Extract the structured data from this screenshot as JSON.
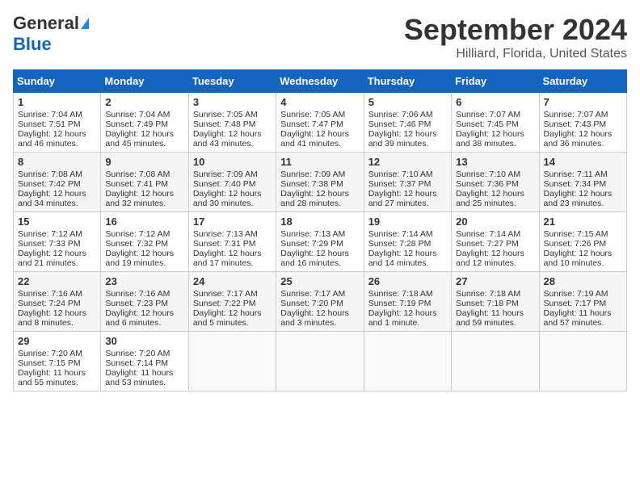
{
  "header": {
    "logo_general": "General",
    "logo_blue": "Blue",
    "month": "September 2024",
    "location": "Hilliard, Florida, United States"
  },
  "days_of_week": [
    "Sunday",
    "Monday",
    "Tuesday",
    "Wednesday",
    "Thursday",
    "Friday",
    "Saturday"
  ],
  "weeks": [
    [
      {
        "day": "1",
        "lines": [
          "Sunrise: 7:04 AM",
          "Sunset: 7:51 PM",
          "Daylight: 12 hours",
          "and 46 minutes."
        ]
      },
      {
        "day": "2",
        "lines": [
          "Sunrise: 7:04 AM",
          "Sunset: 7:49 PM",
          "Daylight: 12 hours",
          "and 45 minutes."
        ]
      },
      {
        "day": "3",
        "lines": [
          "Sunrise: 7:05 AM",
          "Sunset: 7:48 PM",
          "Daylight: 12 hours",
          "and 43 minutes."
        ]
      },
      {
        "day": "4",
        "lines": [
          "Sunrise: 7:05 AM",
          "Sunset: 7:47 PM",
          "Daylight: 12 hours",
          "and 41 minutes."
        ]
      },
      {
        "day": "5",
        "lines": [
          "Sunrise: 7:06 AM",
          "Sunset: 7:46 PM",
          "Daylight: 12 hours",
          "and 39 minutes."
        ]
      },
      {
        "day": "6",
        "lines": [
          "Sunrise: 7:07 AM",
          "Sunset: 7:45 PM",
          "Daylight: 12 hours",
          "and 38 minutes."
        ]
      },
      {
        "day": "7",
        "lines": [
          "Sunrise: 7:07 AM",
          "Sunset: 7:43 PM",
          "Daylight: 12 hours",
          "and 36 minutes."
        ]
      }
    ],
    [
      {
        "day": "8",
        "lines": [
          "Sunrise: 7:08 AM",
          "Sunset: 7:42 PM",
          "Daylight: 12 hours",
          "and 34 minutes."
        ]
      },
      {
        "day": "9",
        "lines": [
          "Sunrise: 7:08 AM",
          "Sunset: 7:41 PM",
          "Daylight: 12 hours",
          "and 32 minutes."
        ]
      },
      {
        "day": "10",
        "lines": [
          "Sunrise: 7:09 AM",
          "Sunset: 7:40 PM",
          "Daylight: 12 hours",
          "and 30 minutes."
        ]
      },
      {
        "day": "11",
        "lines": [
          "Sunrise: 7:09 AM",
          "Sunset: 7:38 PM",
          "Daylight: 12 hours",
          "and 28 minutes."
        ]
      },
      {
        "day": "12",
        "lines": [
          "Sunrise: 7:10 AM",
          "Sunset: 7:37 PM",
          "Daylight: 12 hours",
          "and 27 minutes."
        ]
      },
      {
        "day": "13",
        "lines": [
          "Sunrise: 7:10 AM",
          "Sunset: 7:36 PM",
          "Daylight: 12 hours",
          "and 25 minutes."
        ]
      },
      {
        "day": "14",
        "lines": [
          "Sunrise: 7:11 AM",
          "Sunset: 7:34 PM",
          "Daylight: 12 hours",
          "and 23 minutes."
        ]
      }
    ],
    [
      {
        "day": "15",
        "lines": [
          "Sunrise: 7:12 AM",
          "Sunset: 7:33 PM",
          "Daylight: 12 hours",
          "and 21 minutes."
        ]
      },
      {
        "day": "16",
        "lines": [
          "Sunrise: 7:12 AM",
          "Sunset: 7:32 PM",
          "Daylight: 12 hours",
          "and 19 minutes."
        ]
      },
      {
        "day": "17",
        "lines": [
          "Sunrise: 7:13 AM",
          "Sunset: 7:31 PM",
          "Daylight: 12 hours",
          "and 17 minutes."
        ]
      },
      {
        "day": "18",
        "lines": [
          "Sunrise: 7:13 AM",
          "Sunset: 7:29 PM",
          "Daylight: 12 hours",
          "and 16 minutes."
        ]
      },
      {
        "day": "19",
        "lines": [
          "Sunrise: 7:14 AM",
          "Sunset: 7:28 PM",
          "Daylight: 12 hours",
          "and 14 minutes."
        ]
      },
      {
        "day": "20",
        "lines": [
          "Sunrise: 7:14 AM",
          "Sunset: 7:27 PM",
          "Daylight: 12 hours",
          "and 12 minutes."
        ]
      },
      {
        "day": "21",
        "lines": [
          "Sunrise: 7:15 AM",
          "Sunset: 7:26 PM",
          "Daylight: 12 hours",
          "and 10 minutes."
        ]
      }
    ],
    [
      {
        "day": "22",
        "lines": [
          "Sunrise: 7:16 AM",
          "Sunset: 7:24 PM",
          "Daylight: 12 hours",
          "and 8 minutes."
        ]
      },
      {
        "day": "23",
        "lines": [
          "Sunrise: 7:16 AM",
          "Sunset: 7:23 PM",
          "Daylight: 12 hours",
          "and 6 minutes."
        ]
      },
      {
        "day": "24",
        "lines": [
          "Sunrise: 7:17 AM",
          "Sunset: 7:22 PM",
          "Daylight: 12 hours",
          "and 5 minutes."
        ]
      },
      {
        "day": "25",
        "lines": [
          "Sunrise: 7:17 AM",
          "Sunset: 7:20 PM",
          "Daylight: 12 hours",
          "and 3 minutes."
        ]
      },
      {
        "day": "26",
        "lines": [
          "Sunrise: 7:18 AM",
          "Sunset: 7:19 PM",
          "Daylight: 12 hours",
          "and 1 minute."
        ]
      },
      {
        "day": "27",
        "lines": [
          "Sunrise: 7:18 AM",
          "Sunset: 7:18 PM",
          "Daylight: 11 hours",
          "and 59 minutes."
        ]
      },
      {
        "day": "28",
        "lines": [
          "Sunrise: 7:19 AM",
          "Sunset: 7:17 PM",
          "Daylight: 11 hours",
          "and 57 minutes."
        ]
      }
    ],
    [
      {
        "day": "29",
        "lines": [
          "Sunrise: 7:20 AM",
          "Sunset: 7:15 PM",
          "Daylight: 11 hours",
          "and 55 minutes."
        ]
      },
      {
        "day": "30",
        "lines": [
          "Sunrise: 7:20 AM",
          "Sunset: 7:14 PM",
          "Daylight: 11 hours",
          "and 53 minutes."
        ]
      },
      {
        "day": "",
        "lines": []
      },
      {
        "day": "",
        "lines": []
      },
      {
        "day": "",
        "lines": []
      },
      {
        "day": "",
        "lines": []
      },
      {
        "day": "",
        "lines": []
      }
    ]
  ]
}
